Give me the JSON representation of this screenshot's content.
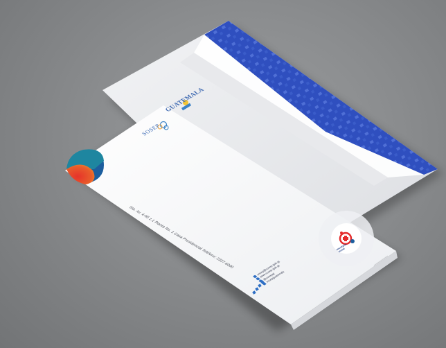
{
  "logos": {
    "guatemala_text": "GUATEMALA",
    "sosep_text": "SOSEP",
    "social_logo_line1": "secretaría",
    "social_logo_line2": "social"
  },
  "address_line": "6ta. Av. 4-65 z.1 Planta No. 1 Casa Presidencial  Teléfono: 2327-6000",
  "social_links": [
    "sosep@sosep.gob.gt",
    "www.sosep.gob.gt",
    "@sosepgt",
    "sosepguatemala"
  ],
  "colors": {
    "background": "#8a8c8e",
    "envelope_pattern": "#2f4fbf",
    "accent_red": "#e42a2a",
    "accent_orange": "#f0892a",
    "accent_blue": "#1c5e9e",
    "accent_teal": "#1e86a0"
  }
}
